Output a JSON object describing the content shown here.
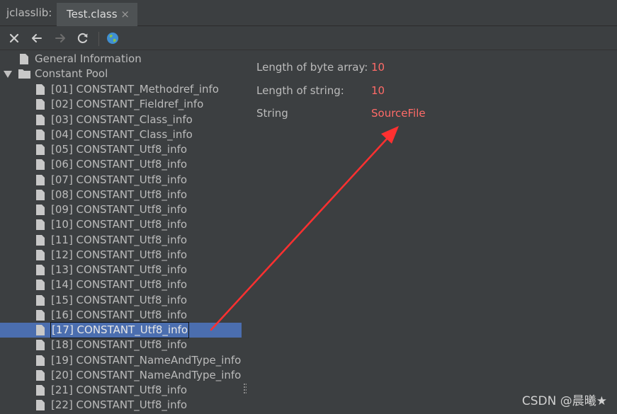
{
  "tabbar": {
    "app_label": "jclasslib:",
    "tab_label": "Test.class",
    "tab_close": "×"
  },
  "tree": {
    "general": "General Information",
    "constant_pool": "Constant Pool",
    "items": [
      "[01] CONSTANT_Methodref_info",
      "[02] CONSTANT_Fieldref_info",
      "[03] CONSTANT_Class_info",
      "[04] CONSTANT_Class_info",
      "[05] CONSTANT_Utf8_info",
      "[06] CONSTANT_Utf8_info",
      "[07] CONSTANT_Utf8_info",
      "[08] CONSTANT_Utf8_info",
      "[09] CONSTANT_Utf8_info",
      "[10] CONSTANT_Utf8_info",
      "[11] CONSTANT_Utf8_info",
      "[12] CONSTANT_Utf8_info",
      "[13] CONSTANT_Utf8_info",
      "[14] CONSTANT_Utf8_info",
      "[15] CONSTANT_Utf8_info",
      "[16] CONSTANT_Utf8_info",
      "[17] CONSTANT_Utf8_info",
      "[18] CONSTANT_Utf8_info",
      "[19] CONSTANT_NameAndType_info",
      "[20] CONSTANT_NameAndType_info",
      "[21] CONSTANT_Utf8_info",
      "[22] CONSTANT_Utf8_info"
    ],
    "selected_index": 16
  },
  "detail": {
    "length_of_byte_array_label": "Length of byte array:",
    "length_of_byte_array_value": "10",
    "length_of_string_label": "Length of string:",
    "length_of_string_value": "10",
    "string_label": "String",
    "string_value": "SourceFile"
  },
  "watermark": "CSDN @晨曦★",
  "colors": {
    "background": "#3c3f41",
    "selection": "#4b6eaf",
    "value_red": "#ff6b68",
    "annotation_arrow": "#ff3030"
  }
}
